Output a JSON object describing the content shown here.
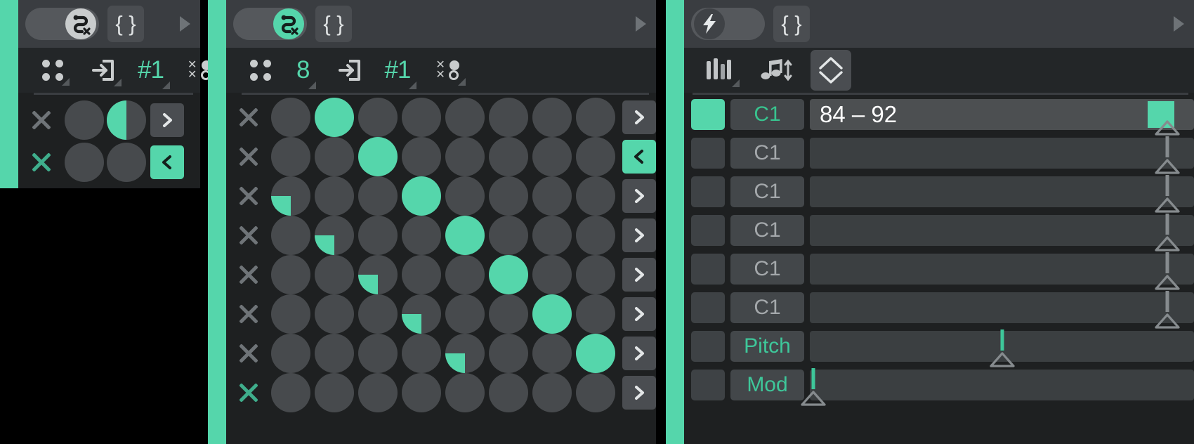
{
  "app": {
    "background": "#000000",
    "accent": "#55d6ab",
    "panel_bg": "#1e2021",
    "toolbar_bg": "#232628",
    "titlebar_bg": "#3a3d41"
  },
  "panels": [
    {
      "id": "euclid-small",
      "name": "Euclidean pattern panel (collapsed)",
      "titlebar": {
        "toggle": {
          "icon": "snake-path-x-icon",
          "state": "off",
          "label": ""
        },
        "braces_button": {
          "icon": "curly-braces-icon",
          "label": "{ }"
        },
        "play_icon": "play-triangle-icon"
      },
      "toolbar": [
        {
          "icon": "four-dots-icon",
          "label": "",
          "has_corner": true
        },
        {
          "icon": "import-arrow-icon",
          "label": "",
          "has_corner": true
        },
        {
          "icon": "",
          "label": "#1",
          "has_corner": true,
          "accent": true
        },
        {
          "icon": "x-o-grid-icon",
          "label": "",
          "has_corner": true
        }
      ],
      "grid": {
        "columns": 2,
        "rows": [
          {
            "x_state": "gray",
            "steps": [
              "off",
              "half-left"
            ],
            "arrow": {
              "dir": "right",
              "active": false
            }
          },
          {
            "x_state": "green",
            "steps": [
              "off",
              "off"
            ],
            "arrow": {
              "dir": "left",
              "active": true
            }
          }
        ]
      }
    },
    {
      "id": "euclid-main",
      "name": "Euclidean pattern panel (main)",
      "titlebar": {
        "toggle": {
          "icon": "snake-path-x-icon",
          "state": "on",
          "label": ""
        },
        "braces_button": {
          "icon": "curly-braces-icon",
          "label": "{ }"
        },
        "play_icon": "play-triangle-icon"
      },
      "toolbar": [
        {
          "icon": "four-dots-icon",
          "label": "",
          "has_corner": false
        },
        {
          "icon": "",
          "label": "8",
          "has_corner": true,
          "accent": true
        },
        {
          "icon": "import-arrow-icon",
          "label": "",
          "has_corner": false
        },
        {
          "icon": "",
          "label": "#1",
          "has_corner": true,
          "accent": true
        },
        {
          "icon": "x-o-grid-icon",
          "label": "",
          "has_corner": true
        }
      ],
      "grid": {
        "columns": 8,
        "rows": [
          {
            "x_state": "gray",
            "steps": [
              "off",
              "on",
              "off",
              "off",
              "off",
              "off",
              "off",
              "off"
            ],
            "arrow": {
              "dir": "right",
              "active": false
            }
          },
          {
            "x_state": "gray",
            "steps": [
              "off",
              "off",
              "on",
              "off",
              "off",
              "off",
              "off",
              "off"
            ],
            "arrow": {
              "dir": "left",
              "active": true
            }
          },
          {
            "x_state": "gray",
            "steps": [
              "quarter",
              "off",
              "off",
              "on",
              "off",
              "off",
              "off",
              "off"
            ],
            "arrow": {
              "dir": "right",
              "active": false
            }
          },
          {
            "x_state": "gray",
            "steps": [
              "off",
              "quarter",
              "off",
              "off",
              "on",
              "off",
              "off",
              "off"
            ],
            "arrow": {
              "dir": "right",
              "active": false
            }
          },
          {
            "x_state": "gray",
            "steps": [
              "off",
              "off",
              "quarter",
              "off",
              "off",
              "on",
              "off",
              "off"
            ],
            "arrow": {
              "dir": "right",
              "active": false
            }
          },
          {
            "x_state": "gray",
            "steps": [
              "off",
              "off",
              "off",
              "quarter",
              "off",
              "off",
              "on",
              "off"
            ],
            "arrow": {
              "dir": "right",
              "active": false
            }
          },
          {
            "x_state": "gray",
            "steps": [
              "off",
              "off",
              "off",
              "off",
              "quarter",
              "off",
              "off",
              "on"
            ],
            "arrow": {
              "dir": "right",
              "active": false
            }
          },
          {
            "x_state": "green",
            "steps": [
              "off",
              "off",
              "off",
              "off",
              "off",
              "off",
              "off",
              "off"
            ],
            "arrow": {
              "dir": "right",
              "active": false
            }
          }
        ]
      }
    },
    {
      "id": "velocity-seq",
      "name": "Velocity / note sequencer panel",
      "titlebar": {
        "toggle": {
          "icon": "lightning-bolt-icon",
          "state": "off",
          "label": ""
        },
        "braces_button": {
          "icon": "curly-braces-icon",
          "label": "{ }"
        },
        "play_icon": "play-triangle-icon"
      },
      "toolbar": [
        {
          "icon": "velocity-bars-icon",
          "label": "",
          "has_corner": true
        },
        {
          "icon": "note-updown-icon",
          "label": "",
          "has_corner": false
        },
        {
          "icon": "diamond-range-icon",
          "label": "",
          "has_corner": false,
          "boxed": true,
          "selected": true
        }
      ],
      "rows": [
        {
          "pad_on": true,
          "note": "C1",
          "note_active": true,
          "value": "84 – 92",
          "highlighted": true,
          "block_pct": 88,
          "marker_pct": 93,
          "marker_green": false,
          "marker_stem": false
        },
        {
          "pad_on": false,
          "note": "C1",
          "note_active": false,
          "value": "",
          "highlighted": false,
          "block_pct": null,
          "marker_pct": 93,
          "marker_green": false,
          "marker_stem": true
        },
        {
          "pad_on": false,
          "note": "C1",
          "note_active": false,
          "value": "",
          "highlighted": false,
          "block_pct": null,
          "marker_pct": 93,
          "marker_green": false,
          "marker_stem": true
        },
        {
          "pad_on": false,
          "note": "C1",
          "note_active": false,
          "value": "",
          "highlighted": false,
          "block_pct": null,
          "marker_pct": 93,
          "marker_green": false,
          "marker_stem": true
        },
        {
          "pad_on": false,
          "note": "C1",
          "note_active": false,
          "value": "",
          "highlighted": false,
          "block_pct": null,
          "marker_pct": 93,
          "marker_green": false,
          "marker_stem": true
        },
        {
          "pad_on": false,
          "note": "C1",
          "note_active": false,
          "value": "",
          "highlighted": false,
          "block_pct": null,
          "marker_pct": 93,
          "marker_green": false,
          "marker_stem": true
        },
        {
          "pad_on": false,
          "note": "Pitch",
          "note_active": false,
          "value": "",
          "highlighted": false,
          "block_pct": null,
          "marker_pct": 50,
          "marker_green": true,
          "marker_stem": true
        },
        {
          "pad_on": false,
          "note": "Mod",
          "note_active": false,
          "value": "",
          "highlighted": false,
          "block_pct": null,
          "marker_pct": 1,
          "marker_green": true,
          "marker_stem": true
        }
      ]
    }
  ]
}
